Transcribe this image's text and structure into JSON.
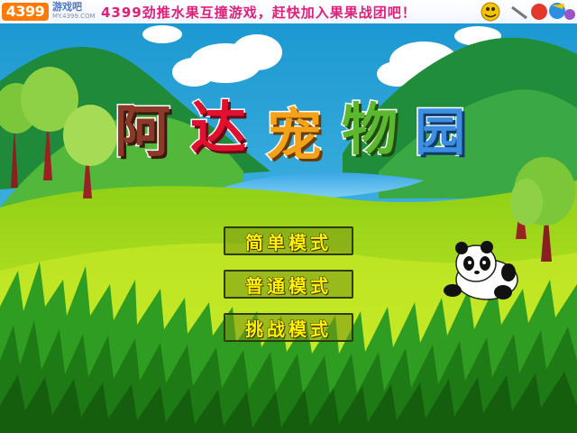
{
  "banner": {
    "logo_number": "4399",
    "logo_text": "游戏吧",
    "logo_url": "MY.4399.COM",
    "slogan": "4399劲推水果互撞游戏，赶快加入果果战团吧！"
  },
  "game": {
    "title_chars": [
      "阿",
      "达",
      "宠",
      "物",
      "园"
    ]
  },
  "menu": {
    "easy_label": "简单模式",
    "normal_label": "普通模式",
    "challenge_label": "挑战模式"
  },
  "colors": {
    "sky": "#2aa6d8",
    "grass_light": "#b8e31c",
    "grass_dark": "#1f7a1a",
    "button_text": "#fff200"
  }
}
